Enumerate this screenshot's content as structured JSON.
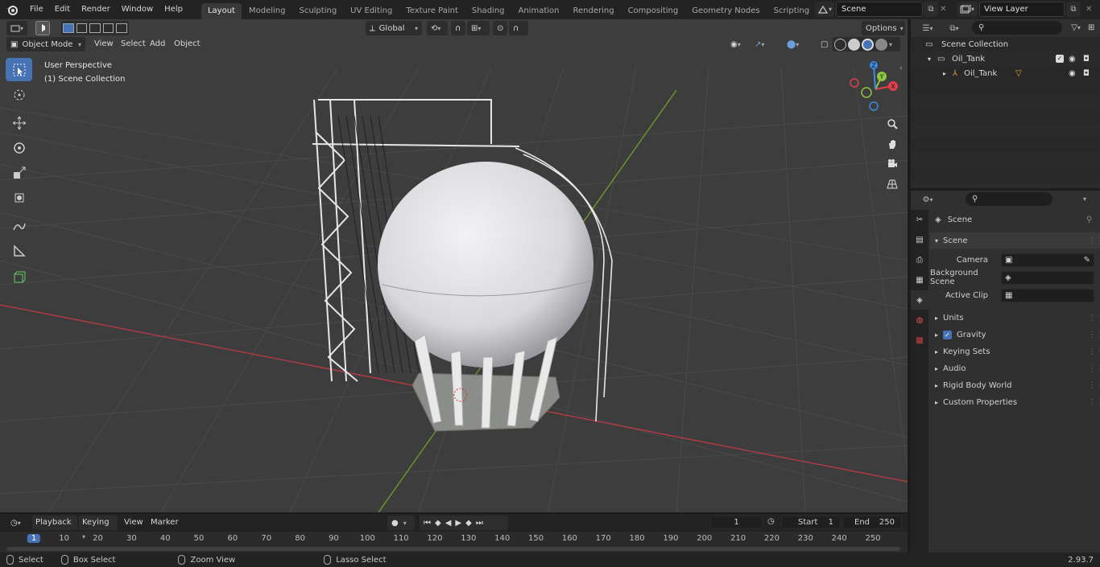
{
  "menus": [
    "File",
    "Edit",
    "Render",
    "Window",
    "Help"
  ],
  "workspaces": [
    "Layout",
    "Modeling",
    "Sculpting",
    "UV Editing",
    "Texture Paint",
    "Shading",
    "Animation",
    "Rendering",
    "Compositing",
    "Geometry Nodes",
    "Scripting"
  ],
  "active_workspace": "Layout",
  "scene_name": "Scene",
  "view_layer": "View Layer",
  "viewport": {
    "mode": "Object Mode",
    "menu": [
      "View",
      "Select",
      "Add",
      "Object"
    ],
    "transform_orientation": "Global",
    "options_label": "Options",
    "perspective_label": "User Perspective",
    "collection_label": "(1) Scene Collection"
  },
  "gizmo": {
    "x": "X",
    "y": "Y",
    "z": "Z"
  },
  "outliner": {
    "root": "Scene Collection",
    "collection": "Oil_Tank",
    "object": "Oil_Tank"
  },
  "properties": {
    "context_title": "Scene",
    "panel_title": "Scene",
    "camera_label": "Camera",
    "background_scene_label": "Background Scene",
    "active_clip_label": "Active Clip",
    "subpanels": [
      "Units",
      "Gravity",
      "Keying Sets",
      "Audio",
      "Rigid Body World",
      "Custom Properties"
    ]
  },
  "timeline": {
    "menu": [
      "Playback",
      "Keying",
      "View",
      "Marker"
    ],
    "current_frame": "1",
    "start_label": "Start",
    "start_value": "1",
    "end_label": "End",
    "end_value": "250",
    "ruler": [
      "1",
      "10",
      "20",
      "30",
      "40",
      "50",
      "60",
      "70",
      "80",
      "90",
      "100",
      "110",
      "120",
      "130",
      "140",
      "150",
      "160",
      "170",
      "180",
      "190",
      "200",
      "210",
      "220",
      "230",
      "240",
      "250"
    ]
  },
  "status": {
    "select": "Select",
    "box_select": "Box Select",
    "zoom_view": "Zoom View",
    "lasso_select": "Lasso Select",
    "version": "2.93.7"
  },
  "colors": {
    "accent": "#4772b3",
    "x_axis": "#e0404a",
    "y_axis": "#8cc63f",
    "z_axis": "#3c8de0"
  }
}
